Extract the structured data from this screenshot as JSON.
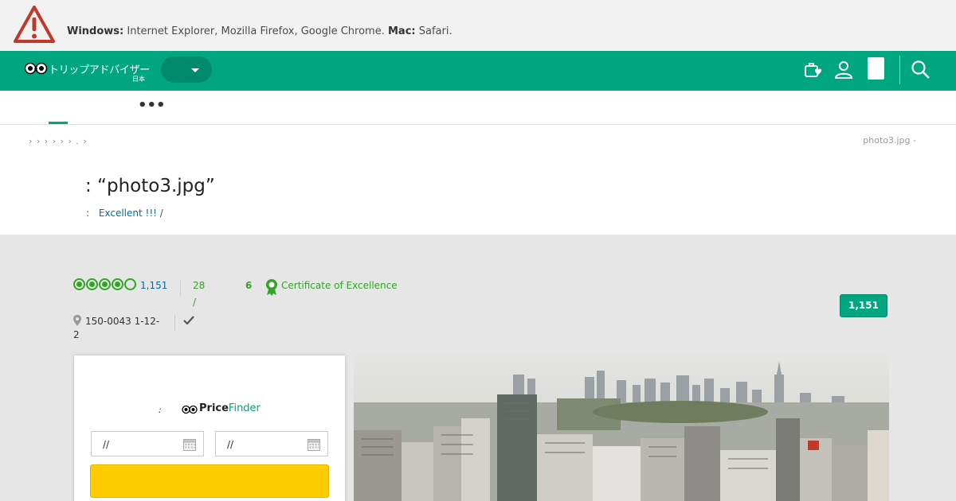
{
  "warning": {
    "windows_label": "Windows:",
    "windows_browsers": "Internet Explorer, Mozilla Firefox, Google Chrome.",
    "mac_label": "Mac:",
    "mac_browsers": "Safari."
  },
  "header": {
    "logo_text": "トリップアドバイザー",
    "logo_region": "日本",
    "icons": [
      "trips-icon",
      "user-icon",
      "search-icon"
    ]
  },
  "nav": {
    "more": "•••"
  },
  "breadcrumbs": "› › › › › › . ›",
  "photo_crumb": "photo3.jpg -",
  "title": ": “photo3.jpg”",
  "review": {
    "prefix": ":",
    "link": "Excellent !!!",
    "suffix": "/"
  },
  "rating": {
    "bubbles": 5,
    "count": "1,151"
  },
  "ranking": {
    "line1": "28",
    "line2": "/"
  },
  "six": "6",
  "certificate": "Certificate of Excellence",
  "count_button": "1,151",
  "address": "150-0043 1-12-2",
  "price_finder": {
    "colon": ":",
    "brand_a": "Price",
    "brand_b": "Finder",
    "checkin": "//",
    "checkout": "//"
  },
  "colors": {
    "brand": "#00a680",
    "rating": "#34a329",
    "link": "#066a9e",
    "cta": "#ffcc00"
  }
}
